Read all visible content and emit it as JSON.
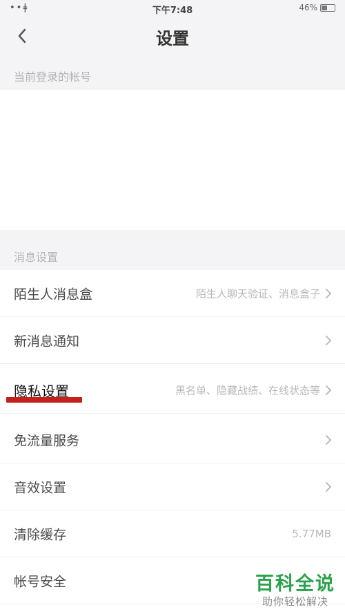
{
  "status_bar": {
    "signal": "••ǂ",
    "time": "下午7:48",
    "battery_text": "46%",
    "battery_level": 0.46
  },
  "nav": {
    "title": "设置"
  },
  "sections": {
    "account_header": "当前登录的帐号",
    "message_header": "消息设置"
  },
  "rows": [
    {
      "label": "陌生人消息盒",
      "value": "陌生人聊天验证、消息盒子",
      "chevron": true
    },
    {
      "label": "新消息通知",
      "value": "",
      "chevron": true
    },
    {
      "label": "隐私设置",
      "value": "黑名单、隐藏战绩、在线状态等",
      "chevron": true
    },
    {
      "label": "免流量服务",
      "value": "",
      "chevron": true
    },
    {
      "label": "音效设置",
      "value": "",
      "chevron": true
    },
    {
      "label": "清除缓存",
      "value": "5.77MB",
      "chevron": false
    },
    {
      "label": "帐号安全",
      "value": "",
      "chevron": false
    }
  ],
  "watermark": {
    "title": "百科全说",
    "subtitle": "助你轻松解决"
  },
  "colors": {
    "highlight_underline": "#c4211c",
    "watermark_green": "#2aa14a",
    "section_bg": "#f4f4f6"
  }
}
